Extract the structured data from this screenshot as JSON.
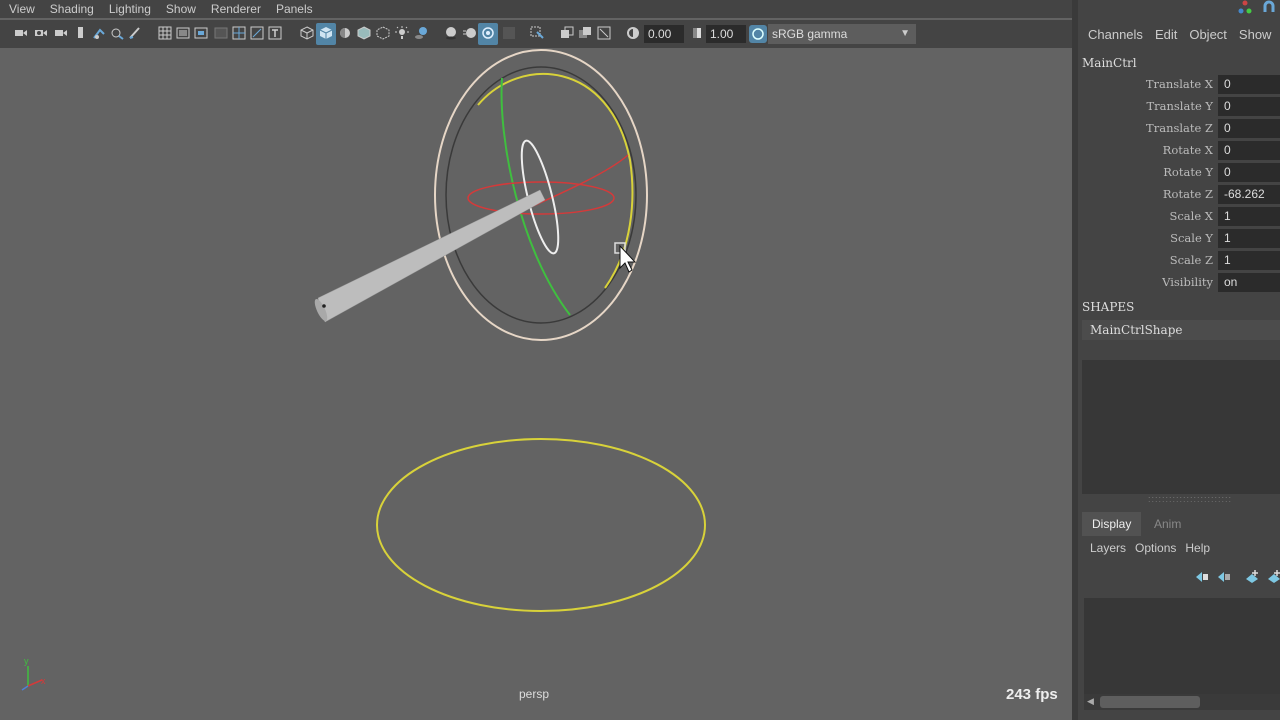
{
  "menubar": [
    "View",
    "Shading",
    "Lighting",
    "Show",
    "Renderer",
    "Panels"
  ],
  "toolbar": {
    "exposure_value": "0.00",
    "gamma_value": "1.00",
    "color_space": "sRGB gamma",
    "icons": [
      "camera-icon",
      "camera-attributes-icon",
      "bookmark-icon",
      "image-plane-icon",
      "grid-icon",
      "wireframe-icon",
      "smooth-shade-icon",
      "lighting-icon",
      "isolate-select-icon",
      "xray-icon",
      "exposure-icon",
      "gamma-icon",
      "color-management-icon"
    ]
  },
  "viewport": {
    "camera_label": "persp",
    "fps": "243 fps",
    "axis_labels": {
      "x": "x",
      "y": "y",
      "z": "z"
    },
    "colors": {
      "background": "#636363",
      "yellow": "#d8d23a",
      "green": "#3fbf3f",
      "red": "#d43a3a"
    }
  },
  "channel_box": {
    "menu": [
      "Channels",
      "Edit",
      "Object",
      "Show"
    ],
    "object_name": "MainCtrl",
    "attributes": [
      {
        "label": "Translate X",
        "value": "0"
      },
      {
        "label": "Translate Y",
        "value": "0"
      },
      {
        "label": "Translate Z",
        "value": "0"
      },
      {
        "label": "Rotate X",
        "value": "0"
      },
      {
        "label": "Rotate Y",
        "value": "0"
      },
      {
        "label": "Rotate Z",
        "value": "-68.262"
      },
      {
        "label": "Scale X",
        "value": "1"
      },
      {
        "label": "Scale Y",
        "value": "1"
      },
      {
        "label": "Scale Z",
        "value": "1"
      },
      {
        "label": "Visibility",
        "value": "on"
      }
    ],
    "shapes_header": "SHAPES",
    "shape_name": "MainCtrlShape"
  },
  "layer_editor": {
    "tabs": [
      "Display",
      "Anim"
    ],
    "menu": [
      "Layers",
      "Options",
      "Help"
    ]
  }
}
